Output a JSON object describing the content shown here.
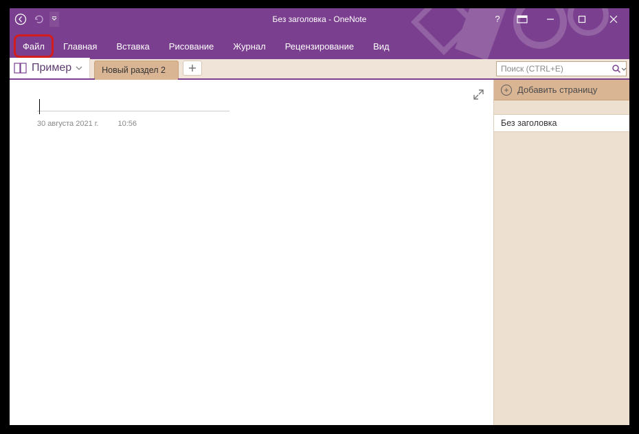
{
  "window": {
    "title": "Без заголовка - OneNote"
  },
  "ribbon": {
    "file": "Файл",
    "tabs": [
      "Главная",
      "Вставка",
      "Рисование",
      "Журнал",
      "Рецензирование",
      "Вид"
    ]
  },
  "notebook": {
    "name": "Пример",
    "section_active": "Новый раздел  2"
  },
  "search": {
    "placeholder": "Поиск (CTRL+E)"
  },
  "page_pane": {
    "add_label": "Добавить страницу",
    "pages": [
      "Без заголовка"
    ]
  },
  "note": {
    "title": "",
    "date": "30 августа 2021 г.",
    "time": "10:56"
  }
}
